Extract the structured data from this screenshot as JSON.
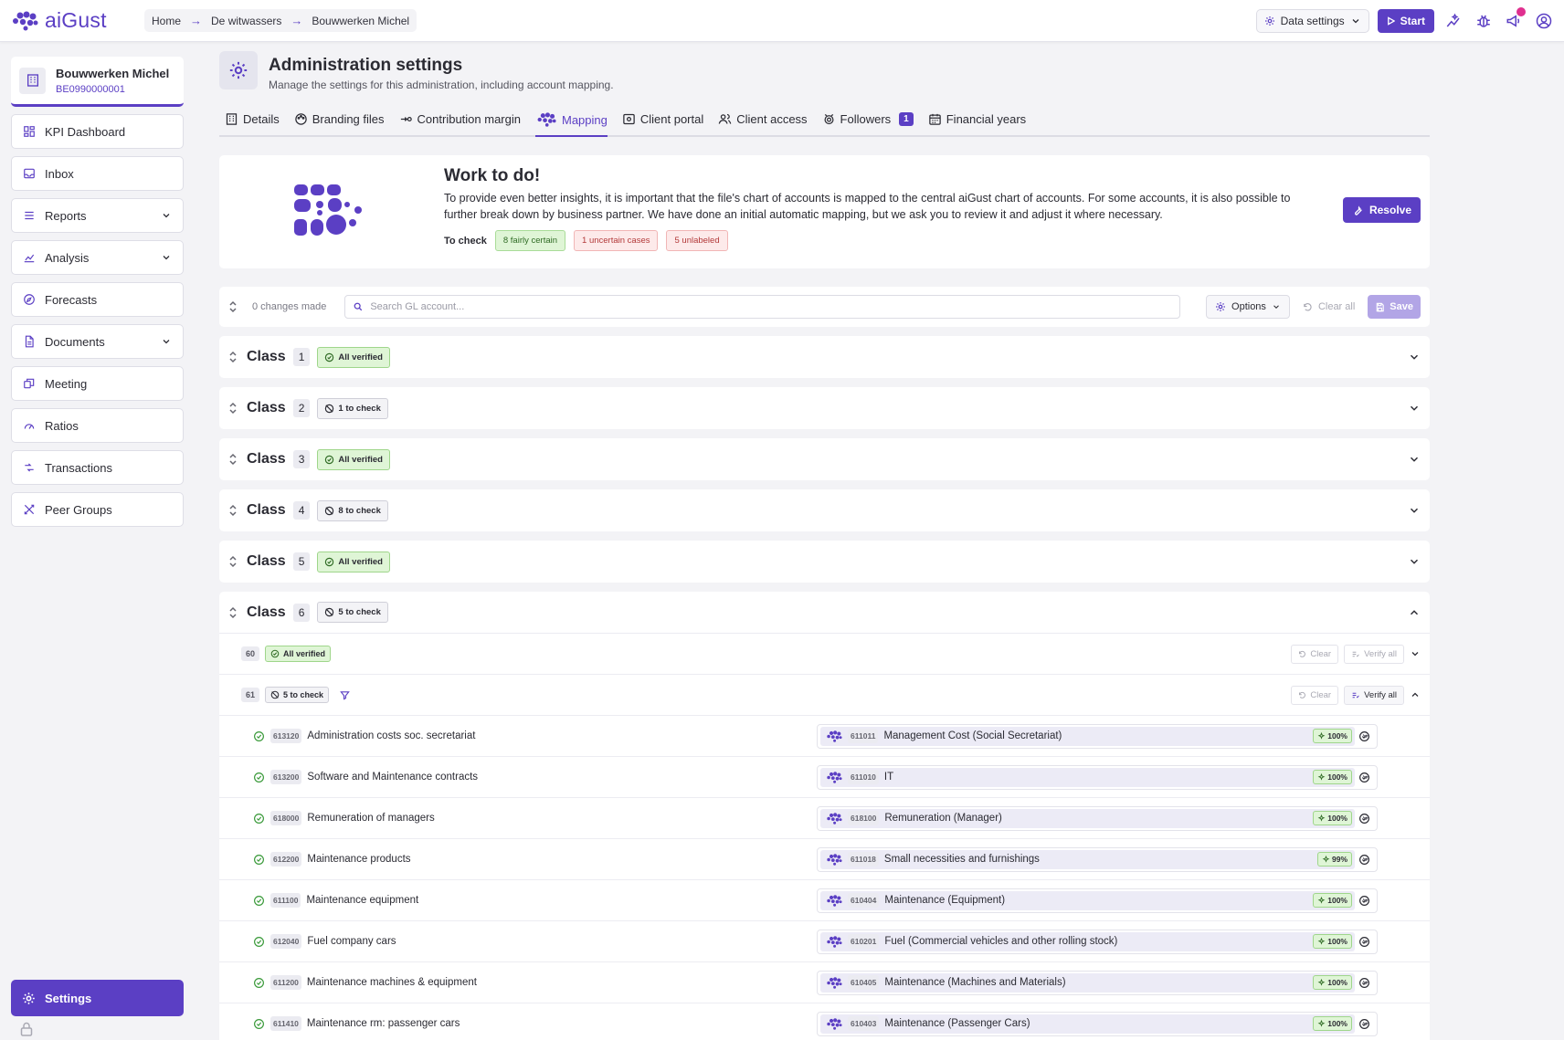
{
  "app": {
    "name": "aiGust",
    "brand_color": "#5b3fc4"
  },
  "breadcrumb": [
    "Home",
    "De witwassers",
    "Bouwwerken Michel"
  ],
  "topbar": {
    "data_settings": "Data settings",
    "start": "Start"
  },
  "organization": {
    "name": "Bouwwerken Michel",
    "id": "BE0990000001"
  },
  "nav": [
    {
      "label": "KPI Dashboard",
      "icon": "dashboard-icon",
      "expandable": false
    },
    {
      "label": "Inbox",
      "icon": "inbox-icon",
      "expandable": false
    },
    {
      "label": "Reports",
      "icon": "reports-icon",
      "expandable": true
    },
    {
      "label": "Analysis",
      "icon": "analysis-icon",
      "expandable": true
    },
    {
      "label": "Forecasts",
      "icon": "forecast-icon",
      "expandable": false
    },
    {
      "label": "Documents",
      "icon": "document-icon",
      "expandable": true
    },
    {
      "label": "Meeting",
      "icon": "meeting-icon",
      "expandable": false
    },
    {
      "label": "Ratios",
      "icon": "ratio-icon",
      "expandable": false
    },
    {
      "label": "Transactions",
      "icon": "transactions-icon",
      "expandable": false
    },
    {
      "label": "Peer Groups",
      "icon": "peer-groups-icon",
      "expandable": false
    }
  ],
  "settings_nav": "Settings",
  "page": {
    "title": "Administration settings",
    "subtitle": "Manage the settings for this administration, including account mapping."
  },
  "tabs": [
    {
      "label": "Details",
      "active": false
    },
    {
      "label": "Branding files",
      "active": false
    },
    {
      "label": "Contribution margin",
      "active": false
    },
    {
      "label": "Mapping",
      "active": true
    },
    {
      "label": "Client portal",
      "active": false
    },
    {
      "label": "Client access",
      "active": false
    },
    {
      "label": "Followers",
      "active": false,
      "badge": "1"
    },
    {
      "label": "Financial years",
      "active": false
    }
  ],
  "todo": {
    "title": "Work to do!",
    "text": "To provide even better insights, it is important that the file's chart of accounts is mapped to the central aiGust chart of accounts. For some accounts, it is also possible to further break down by business partner. We have done an initial automatic mapping, but we ask you to review it and adjust it where necessary.",
    "to_check_label": "To check",
    "chips": [
      "8 fairly certain",
      "1 uncertain cases",
      "5 unlabeled"
    ],
    "resolve": "Resolve"
  },
  "toolbar": {
    "changes": "0 changes made",
    "search_placeholder": "Search GL account...",
    "options": "Options",
    "clear_all": "Clear all",
    "save": "Save"
  },
  "class_label": "Class",
  "classes": [
    {
      "num": "1",
      "status": "All verified",
      "verified": true
    },
    {
      "num": "2",
      "status": "1 to check",
      "verified": false
    },
    {
      "num": "3",
      "status": "All verified",
      "verified": true
    },
    {
      "num": "4",
      "status": "8 to check",
      "verified": false
    },
    {
      "num": "5",
      "status": "All verified",
      "verified": true
    }
  ],
  "class6": {
    "num": "6",
    "status": "5 to check",
    "subgroups": [
      {
        "num": "60",
        "status": "All verified",
        "clear": "Clear",
        "verify_all": "Verify all"
      },
      {
        "num": "61",
        "status": "5 to check",
        "clear": "Clear",
        "verify_all": "Verify all"
      }
    ],
    "accounts": [
      {
        "code": "613120",
        "name": "Administration costs soc. secretariat",
        "map_code": "611011",
        "map_name": "Management Cost (Social Secretariat)",
        "pct": "100%"
      },
      {
        "code": "613200",
        "name": "Software and Maintenance contracts",
        "map_code": "611010",
        "map_name": "IT",
        "pct": "100%"
      },
      {
        "code": "618000",
        "name": "Remuneration of managers",
        "map_code": "618100",
        "map_name": "Remuneration (Manager)",
        "pct": "100%"
      },
      {
        "code": "612200",
        "name": "Maintenance products",
        "map_code": "611018",
        "map_name": "Small necessities and furnishings",
        "pct": "99%"
      },
      {
        "code": "611100",
        "name": "Maintenance equipment",
        "map_code": "610404",
        "map_name": "Maintenance (Equipment)",
        "pct": "100%"
      },
      {
        "code": "612040",
        "name": "Fuel company cars",
        "map_code": "610201",
        "map_name": "Fuel (Commercial vehicles and other rolling stock)",
        "pct": "100%"
      },
      {
        "code": "611200",
        "name": "Maintenance machines & equipment",
        "map_code": "610405",
        "map_name": "Maintenance (Machines and Materials)",
        "pct": "100%"
      },
      {
        "code": "611410",
        "name": "Maintenance rm: passenger cars",
        "map_code": "610403",
        "map_name": "Maintenance (Passenger Cars)",
        "pct": "100%"
      }
    ]
  }
}
